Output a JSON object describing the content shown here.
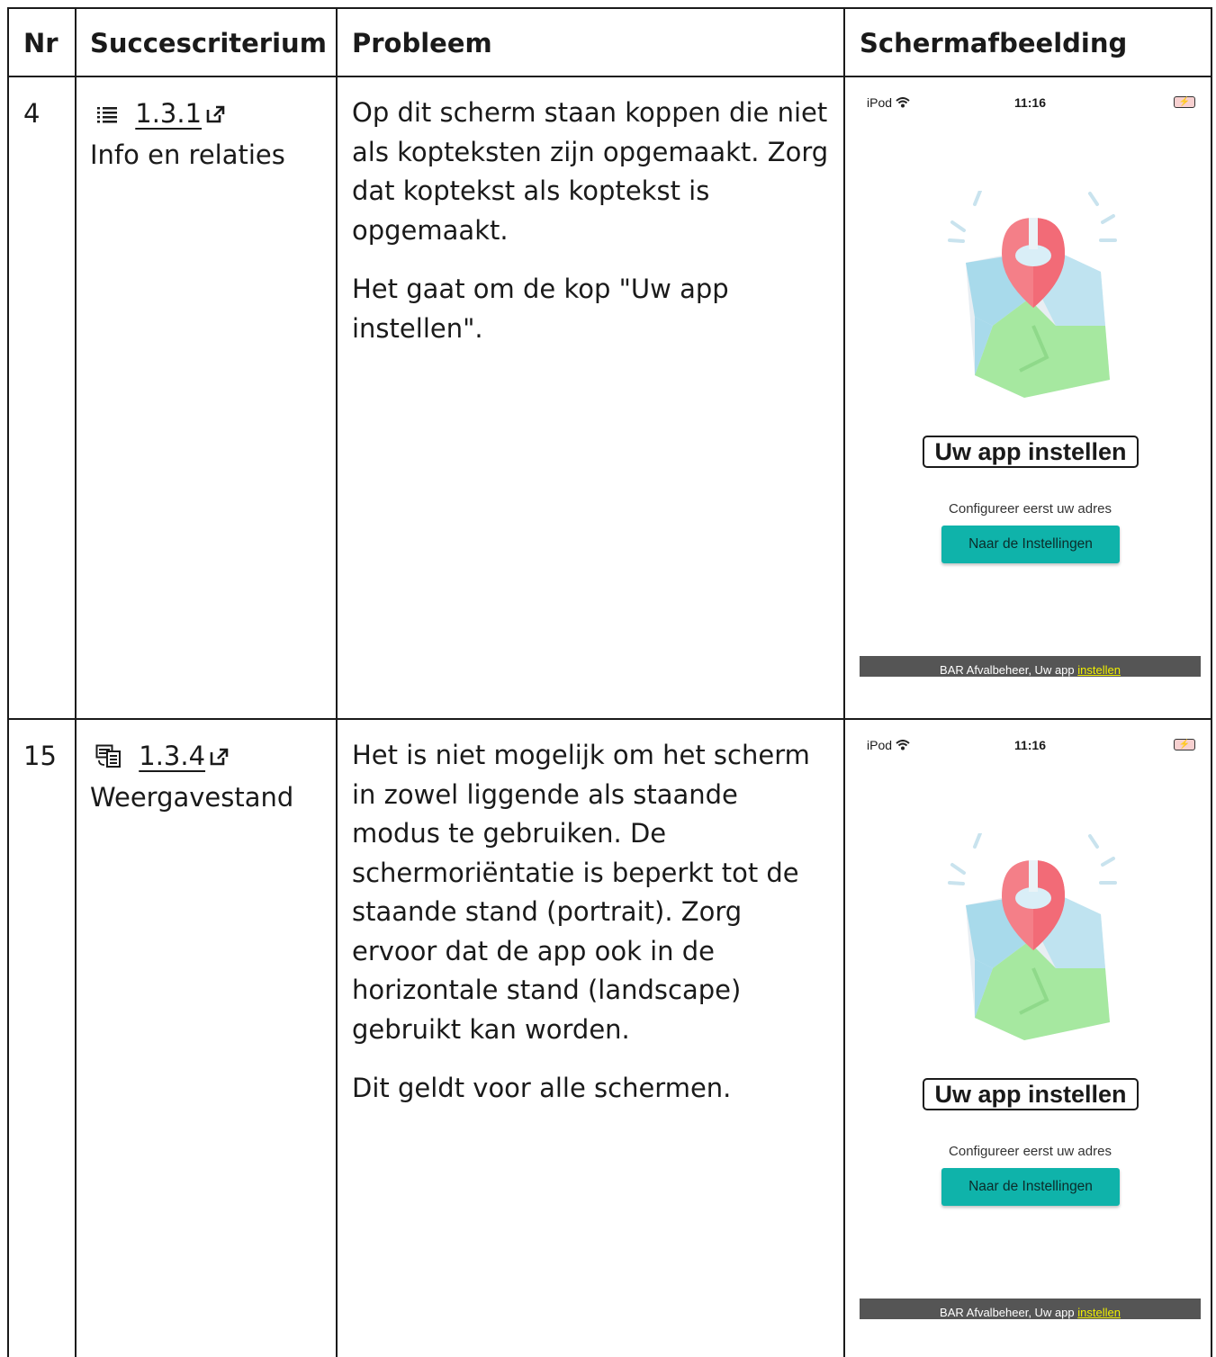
{
  "table": {
    "headers": {
      "nr": "Nr",
      "criterion": "Succescriterium",
      "problem": "Probleem",
      "screenshot": "Schermafbeelding"
    },
    "rows": [
      {
        "nr": "4",
        "criterion_icon": "list-lines-icon",
        "criterion_code": "1.3.1",
        "criterion_name": "Info en relaties",
        "problem": [
          "Op dit scherm staan koppen die niet als kopteksten zijn opgemaakt. Zorg dat koptekst als koptekst is opgemaakt.",
          "Het gaat om de kop \"Uw app instellen\"."
        ]
      },
      {
        "nr": "15",
        "criterion_icon": "rotate-screen-icon",
        "criterion_code": "1.3.4",
        "criterion_name": "Weergavestand",
        "problem": [
          "Het is niet mogelijk om het scherm in zowel liggende als staande modus te gebruiken. De schermoriëntatie is beperkt tot de staande stand (portrait). Zorg ervoor dat de app ook in de horizontale stand (landscape) gebruikt kan worden.",
          "Dit geldt voor alle schermen."
        ]
      }
    ]
  },
  "app_screenshot": {
    "carrier": "iPod",
    "time": "11:16",
    "title": "Uw app instellen",
    "subtitle": "Configureer eerst uw adres",
    "button_label": "Naar de Instellingen",
    "footer_prefix": "BAR Afvalbeheer, Uw app ",
    "footer_highlight": "instellen"
  },
  "colors": {
    "border": "#1a1a1a",
    "button_bg": "#0fb3aa",
    "footer_bg": "#555555",
    "footer_highlight": "#f1f100",
    "pin_red": "#f47f88",
    "map_blue": "#a8daeb",
    "map_green": "#a6e8a0"
  }
}
